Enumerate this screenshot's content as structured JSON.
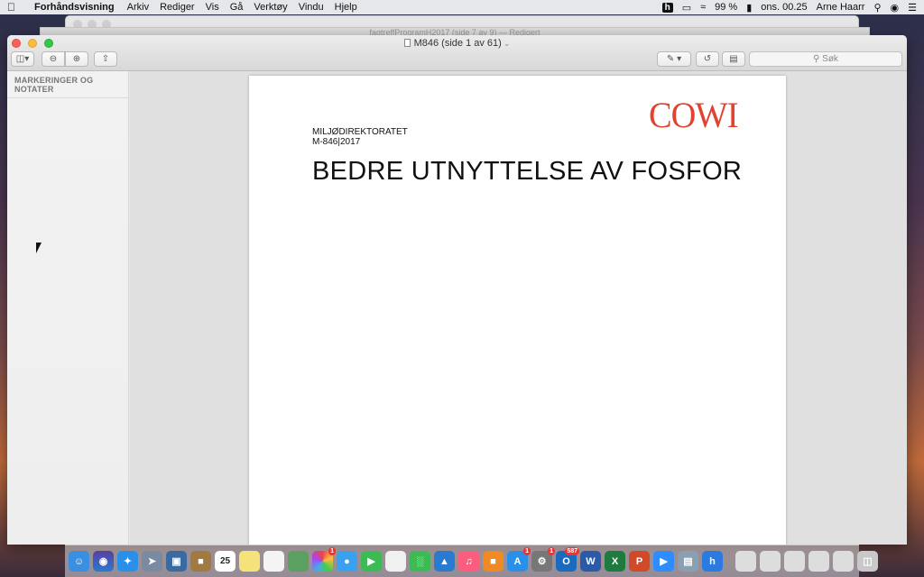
{
  "menubar": {
    "app_name": "Forhåndsvisning",
    "menus": [
      "Arkiv",
      "Rediger",
      "Vis",
      "Gå",
      "Verktøy",
      "Vindu",
      "Hjelp"
    ],
    "battery": "99 %",
    "clock": "ons. 00.25",
    "user": "Arne Haarr"
  },
  "background_window": {
    "title": "fagtreffProgramH2017 (side 7 av 9) — Redigert"
  },
  "window": {
    "title": "M846 (side 1 av 61)",
    "search_placeholder": "Søk"
  },
  "sidebar": {
    "header": "MARKERINGER OG NOTATER"
  },
  "document": {
    "logo": "COWI",
    "org": "MILJØDIREKTORATET",
    "report_number": "M-846|2017",
    "title": "BEDRE UTNYTTELSE AV FOSFOR"
  },
  "dock": {
    "calendar_day": "25",
    "badges": {
      "photos": "1",
      "appstore": "1",
      "prefs": "1",
      "outlook": "587"
    }
  },
  "colors": {
    "logo_red": "#e2422e",
    "close": "#fc605b",
    "minimize": "#fdbc40",
    "maximize": "#34c84a"
  }
}
